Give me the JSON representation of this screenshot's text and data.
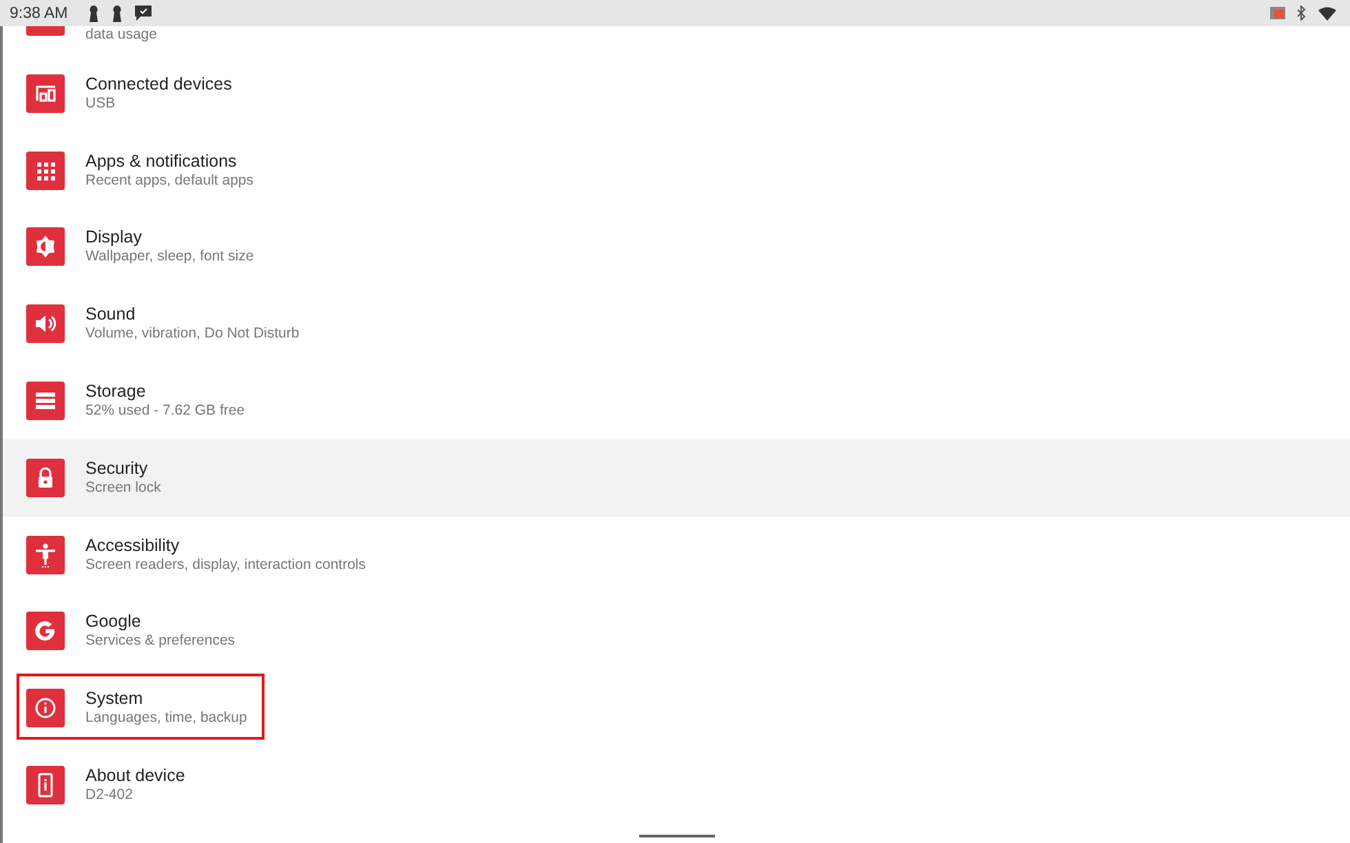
{
  "status_bar": {
    "time": "9:38 AM"
  },
  "settings": [
    {
      "subtitle": "data usage",
      "selected": false,
      "outlined": false
    },
    {
      "title": "Connected devices",
      "subtitle": "USB",
      "selected": false,
      "outlined": false
    },
    {
      "title": "Apps & notifications",
      "subtitle": "Recent apps, default apps",
      "selected": false,
      "outlined": false
    },
    {
      "title": "Display",
      "subtitle": "Wallpaper, sleep, font size",
      "selected": false,
      "outlined": false
    },
    {
      "title": "Sound",
      "subtitle": "Volume, vibration, Do Not Disturb",
      "selected": false,
      "outlined": false
    },
    {
      "title": "Storage",
      "subtitle": "52% used - 7.62 GB free",
      "selected": false,
      "outlined": false
    },
    {
      "title": "Security",
      "subtitle": "Screen lock",
      "selected": true,
      "outlined": false
    },
    {
      "title": "Accessibility",
      "subtitle": "Screen readers, display, interaction controls",
      "selected": false,
      "outlined": false
    },
    {
      "title": "Google",
      "subtitle": "Services & preferences",
      "selected": false,
      "outlined": false
    },
    {
      "title": "System",
      "subtitle": "Languages, time, backup",
      "selected": false,
      "outlined": true
    },
    {
      "title": "About device",
      "subtitle": "D2-402",
      "selected": false,
      "outlined": false
    }
  ]
}
